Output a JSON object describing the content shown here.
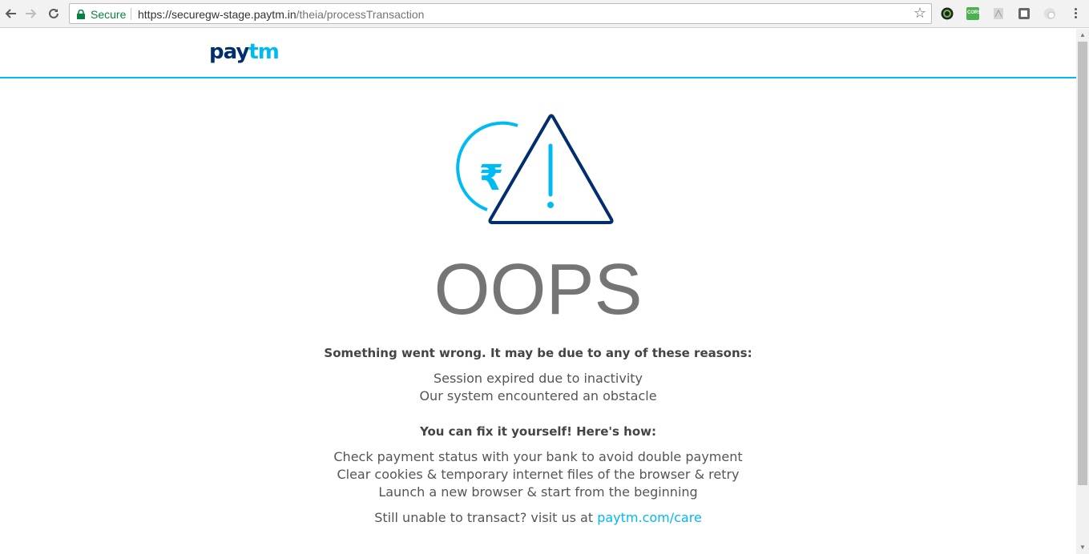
{
  "browser": {
    "secure_label": "Secure",
    "url_host": "https://securegw-stage.paytm.in",
    "url_path": "/theia/processTransaction",
    "extensions": [
      "chrome-extension-icon",
      "cors-extension-icon",
      "pdf-extension-icon",
      "extension-icon",
      "extension-icon"
    ],
    "cors_label": "CORS"
  },
  "header": {
    "logo_pay": "pay",
    "logo_tm": "tm"
  },
  "error": {
    "graphic_symbol": "₹",
    "title": "OOPS",
    "reasons_heading": "Something went wrong. It may be due to any of these reasons:",
    "reasons": [
      "Session expired due to inactivity",
      "Our system encountered an obstacle"
    ],
    "fix_heading": "You can fix it yourself! Here's how:",
    "fixes": [
      "Check payment status with your bank to avoid double payment",
      "Clear cookies & temporary internet files of the browser & retry",
      "Launch a new browser & start from the beginning"
    ],
    "footer_text": "Still unable to transact? visit us at ",
    "footer_link": "paytm.com/care"
  },
  "colors": {
    "brand_dark": "#002e6e",
    "brand_light": "#00baf2",
    "secure_green": "#0b8043"
  }
}
